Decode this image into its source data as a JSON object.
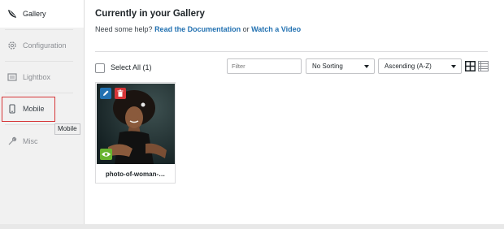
{
  "sidebar": {
    "items": [
      {
        "label": "Gallery",
        "icon": "gallery-logo-icon"
      },
      {
        "label": "Configuration",
        "icon": "gear-icon"
      },
      {
        "label": "Lightbox",
        "icon": "lightbox-icon"
      },
      {
        "label": "Mobile",
        "icon": "mobile-phone-icon"
      },
      {
        "label": "Misc",
        "icon": "wrench-icon"
      }
    ],
    "tooltip": "Mobile",
    "highlight_color": "#d63638"
  },
  "main": {
    "title": "Currently in your Gallery",
    "help_prefix": "Need some help?",
    "help_link_docs": "Read the Documentation",
    "help_or": "or",
    "help_link_video": "Watch a Video",
    "select_all_label": "Select All (1)",
    "filter_placeholder": "Filter",
    "sort_value": "No Sorting",
    "order_value": "Ascending (A-Z)",
    "items": [
      {
        "caption": "photo-of-woman-…"
      }
    ]
  },
  "colors": {
    "link": "#2271b1",
    "edit_button": "#2271b1",
    "delete_button": "#d63638",
    "view_button": "#68b32f"
  }
}
